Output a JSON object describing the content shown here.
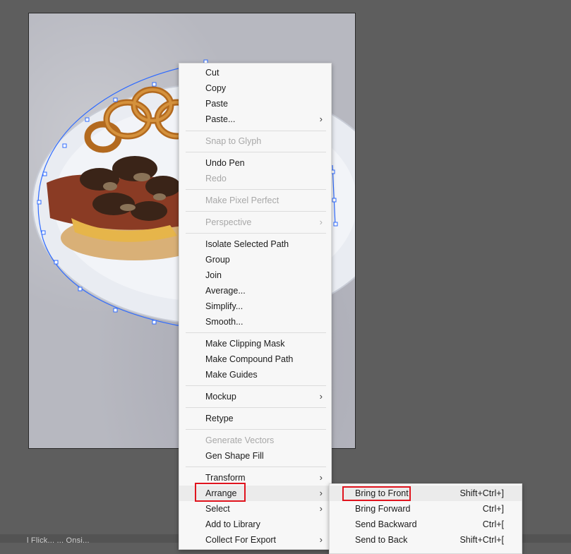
{
  "status": {
    "text": "l Flick...  ...  Onsi..."
  },
  "context_menu": {
    "items": [
      {
        "label": "Cut"
      },
      {
        "label": "Copy"
      },
      {
        "label": "Paste"
      },
      {
        "label": "Paste...",
        "chevron": "›"
      },
      {
        "label": "Snap to Glyph"
      },
      {
        "label": "Undo Pen"
      },
      {
        "label": "Redo"
      },
      {
        "label": "Make Pixel Perfect"
      },
      {
        "label": "Perspective",
        "chevron": "›"
      },
      {
        "label": "Isolate Selected Path"
      },
      {
        "label": "Group"
      },
      {
        "label": "Join"
      },
      {
        "label": "Average..."
      },
      {
        "label": "Simplify..."
      },
      {
        "label": "Smooth..."
      },
      {
        "label": "Make Clipping Mask"
      },
      {
        "label": "Make Compound Path"
      },
      {
        "label": "Make Guides"
      },
      {
        "label": "Mockup",
        "chevron": "›"
      },
      {
        "label": "Retype"
      },
      {
        "label": "Generate Vectors"
      },
      {
        "label": "Gen Shape Fill"
      },
      {
        "label": "Transform",
        "chevron": "›"
      },
      {
        "label": "Arrange",
        "chevron": "›"
      },
      {
        "label": "Select",
        "chevron": "›"
      },
      {
        "label": "Add to Library"
      },
      {
        "label": "Collect For Export",
        "chevron": "›"
      }
    ]
  },
  "arrange_submenu": {
    "items": [
      {
        "label": "Bring to Front",
        "shortcut": "Shift+Ctrl+]"
      },
      {
        "label": "Bring Forward",
        "shortcut": "Ctrl+]"
      },
      {
        "label": "Send Backward",
        "shortcut": "Ctrl+["
      },
      {
        "label": "Send to Back",
        "shortcut": "Shift+Ctrl+["
      }
    ]
  },
  "colors": {
    "canvas_bg": "#5e5e5e",
    "menu_bg": "#f7f7f7",
    "disabled_text": "#a8a8a8",
    "annotation_red": "#e0141e",
    "selection_blue": "#2f6bff"
  }
}
